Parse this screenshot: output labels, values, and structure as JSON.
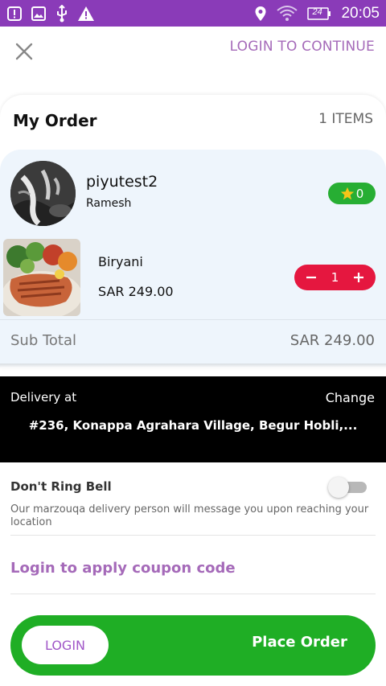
{
  "status_bar": {
    "time": "20:05",
    "battery": "24"
  },
  "header": {
    "close_icon": "close-icon",
    "login_continue": "LOGIN TO CONTINUE"
  },
  "order": {
    "title": "My Order",
    "item_count": "1 ITEMS",
    "store": {
      "name": "piyutest2",
      "owner": "Ramesh",
      "rating": "0"
    },
    "items": [
      {
        "name": "Biryani",
        "price": "SAR 249.00",
        "quantity": "1"
      }
    ],
    "subtotal_label": "Sub Total",
    "subtotal_value": "SAR 249.00"
  },
  "delivery": {
    "label": "Delivery at",
    "change": "Change",
    "address": "#236, Konappa Agrahara Village, Begur Hobli,..."
  },
  "ring_bell": {
    "title": "Don't Ring Bell",
    "description": "Our marzouqa delivery person will message you upon reaching your location",
    "enabled": false
  },
  "coupon": {
    "label": "Login to apply coupon code"
  },
  "footer": {
    "login_label": "LOGIN",
    "place_order_label": "Place Order"
  },
  "colors": {
    "status_bar": "#8a3bb8",
    "accent_purple": "#a56ab9",
    "green": "#1fae25",
    "red": "#e5173f"
  }
}
